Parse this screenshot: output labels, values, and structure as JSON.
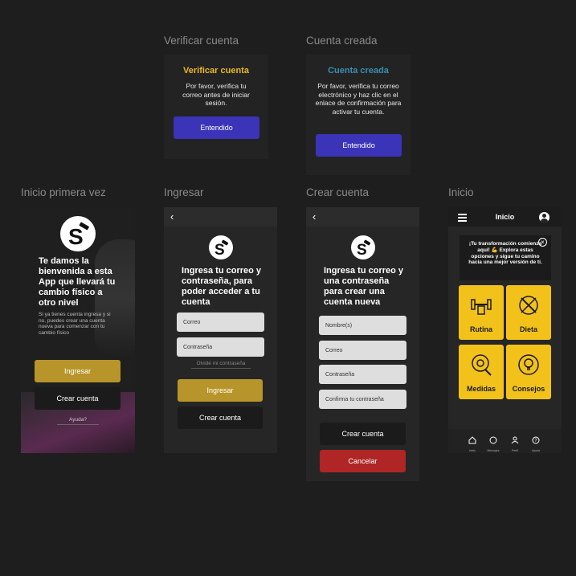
{
  "labels": {
    "verificar": "Verificar cuenta",
    "cuenta_creada": "Cuenta creada",
    "inicio_primera": "Inicio primera vez",
    "ingresar": "Ingresar",
    "crear": "Crear cuenta",
    "inicio": "Inicio"
  },
  "verify_dialog": {
    "title": "Verificar cuenta",
    "body": "Por favor, verifica tu correo antes de iniciar sesión.",
    "button": "Entendido",
    "title_color": "#e9b822"
  },
  "created_dialog": {
    "title": "Cuenta creada",
    "body": "Por favor, verifica tu correo electrónico y haz clic en el enlace de confirmación para activar tu cuenta.",
    "button": "Entendido",
    "title_color": "#3a8fb0"
  },
  "welcome": {
    "heading": "Te damos la bienvenida a esta App que llevará tu cambio físico a otro nivel",
    "subtext": "Si ya tienes cuenta ingresa y si no, puedes crear una cuenta nueva para comenzar con tu cambio físico",
    "login_button": "Ingresar",
    "create_button": "Crear cuenta",
    "help_link": "Ayuda?"
  },
  "login": {
    "heading": "Ingresa tu correo y contraseña, para poder acceder a tu cuenta",
    "email_placeholder": "Correo",
    "password_placeholder": "Contraseña",
    "forgot": "Olvidé mi contraseña",
    "login_button": "Ingresar",
    "create_button": "Crear cuenta"
  },
  "register": {
    "heading": "Ingresa tu correo y una contraseña para crear una cuenta nueva",
    "name_placeholder": "Nombre(s)",
    "email_placeholder": "Correo",
    "password_placeholder": "Contraseña",
    "confirm_placeholder": "Confirma tu contraseña",
    "create_button": "Crear cuenta",
    "cancel_button": "Cancelar"
  },
  "home": {
    "title": "Inicio",
    "banner": "¡Tu transformación comienza aquí! 💪 Explora estas opciones y sigue tu camino hacia una mejor versión de ti.",
    "cards": [
      "Rutina",
      "Dieta",
      "Medidas",
      "Consejos"
    ],
    "nav": [
      "Inicio",
      "Mensajes",
      "Perfil",
      "Ayuda"
    ]
  },
  "colors": {
    "accent_gold": "#f2c21b",
    "button_gold": "#b8952a",
    "button_blue": "#3b33b8",
    "cancel_red": "#b02525"
  }
}
